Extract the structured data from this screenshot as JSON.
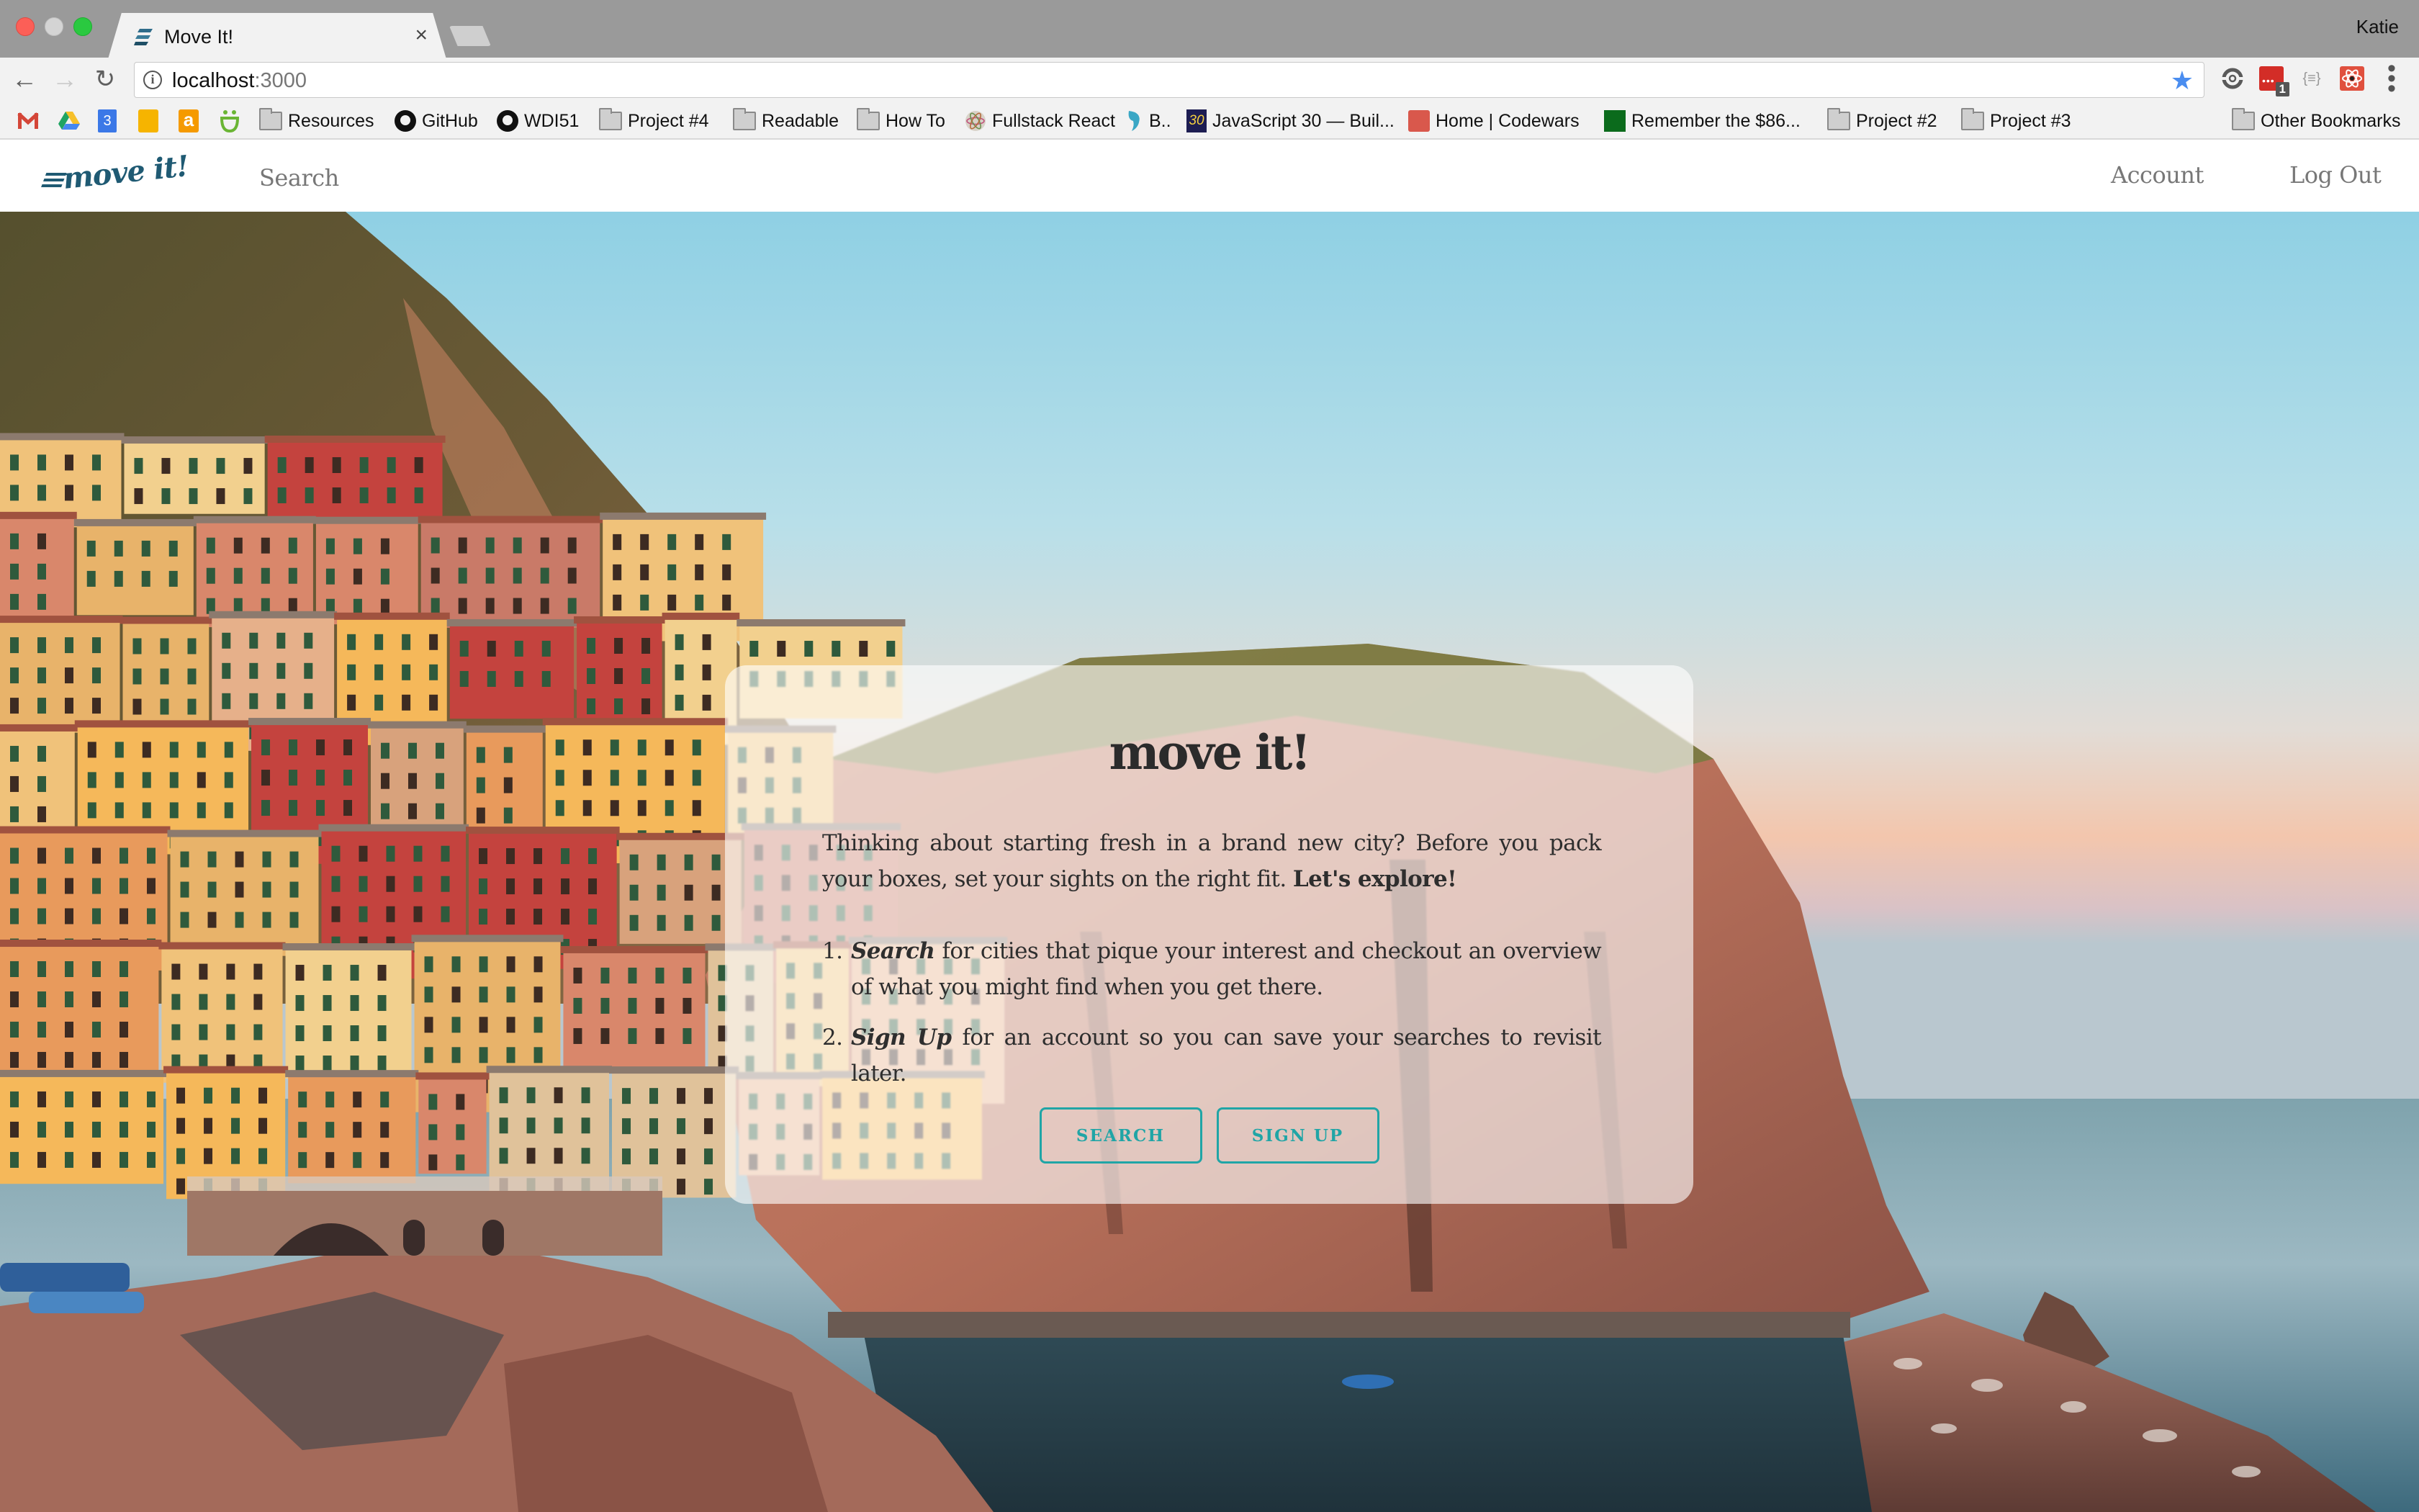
{
  "browser": {
    "tab_title": "Move It!",
    "tab_close": "×",
    "profile_name": "Katie",
    "url_host": "localhost",
    "url_port": ":3000",
    "info_icon_glyph": "i",
    "star_glyph": "★",
    "back_glyph": "←",
    "forward_glyph": "→",
    "reload_glyph": "↻",
    "menu_glyph": "⋮",
    "extension_badge": "1",
    "json_ext_glyph": "{≡}",
    "bookmarks": [
      {
        "label": "",
        "icon": "gmail-icon",
        "color": "#d44638"
      },
      {
        "label": "",
        "icon": "google-drive-icon",
        "color": "#1fa463"
      },
      {
        "label": "",
        "icon": "google-calendar-icon",
        "color": "#3b78e7",
        "glyph": "3"
      },
      {
        "label": "",
        "icon": "google-keep-icon",
        "color": "#f6b400"
      },
      {
        "label": "",
        "icon": "amazon-icon",
        "color": "#f59a00",
        "glyph": "a"
      },
      {
        "label": "",
        "icon": "smile-icon",
        "color": "#6ab534"
      },
      {
        "label": "Resources",
        "icon": "folder-icon"
      },
      {
        "label": "GitHub",
        "icon": "github-icon"
      },
      {
        "label": "WDI51",
        "icon": "github-icon"
      },
      {
        "label": "Project #4",
        "icon": "folder-icon"
      },
      {
        "label": "Readable",
        "icon": "folder-icon"
      },
      {
        "label": "How To",
        "icon": "folder-icon"
      },
      {
        "label": "Fullstack React",
        "icon": "react-atom-icon",
        "color": "#b8b0a6"
      },
      {
        "label": "B..",
        "icon": "dolphin-icon",
        "color": "#3aa7c5"
      },
      {
        "label": "JavaScript 30 — Buil...",
        "icon": "javascript30-icon",
        "color": "#1d1d52",
        "glyph": "30"
      },
      {
        "label": "Home | Codewars",
        "icon": "codewars-icon",
        "color": "#d9584c"
      },
      {
        "label": "Remember the $86...",
        "icon": "remember-icon",
        "color": "#0b6b1c"
      },
      {
        "label": "Project #2",
        "icon": "folder-icon"
      },
      {
        "label": "Project #3",
        "icon": "folder-icon"
      }
    ],
    "other_bookmarks": "Other Bookmarks"
  },
  "app": {
    "logo_text": "move it!",
    "nav": {
      "search": "Search",
      "account": "Account",
      "logout": "Log Out"
    },
    "card": {
      "title": "move it!",
      "intro_text": "Thinking about starting fresh in a brand new city? Before you pack your boxes, set your sights on the right fit. ",
      "intro_bold": "Let's explore!",
      "steps": [
        {
          "number": "1.",
          "bold": "Search",
          "text": " for cities that pique your interest and checkout an overview of what you might find when you get there."
        },
        {
          "number": "2.",
          "bold": "Sign Up",
          "text": " for an account so you can save your searches to revisit later."
        }
      ],
      "search_button": "SEARCH",
      "signup_button": "SIGN UP"
    },
    "colors": {
      "brand": "#1f5a73",
      "accent": "#20a5a6",
      "nav_text": "#777777"
    }
  }
}
